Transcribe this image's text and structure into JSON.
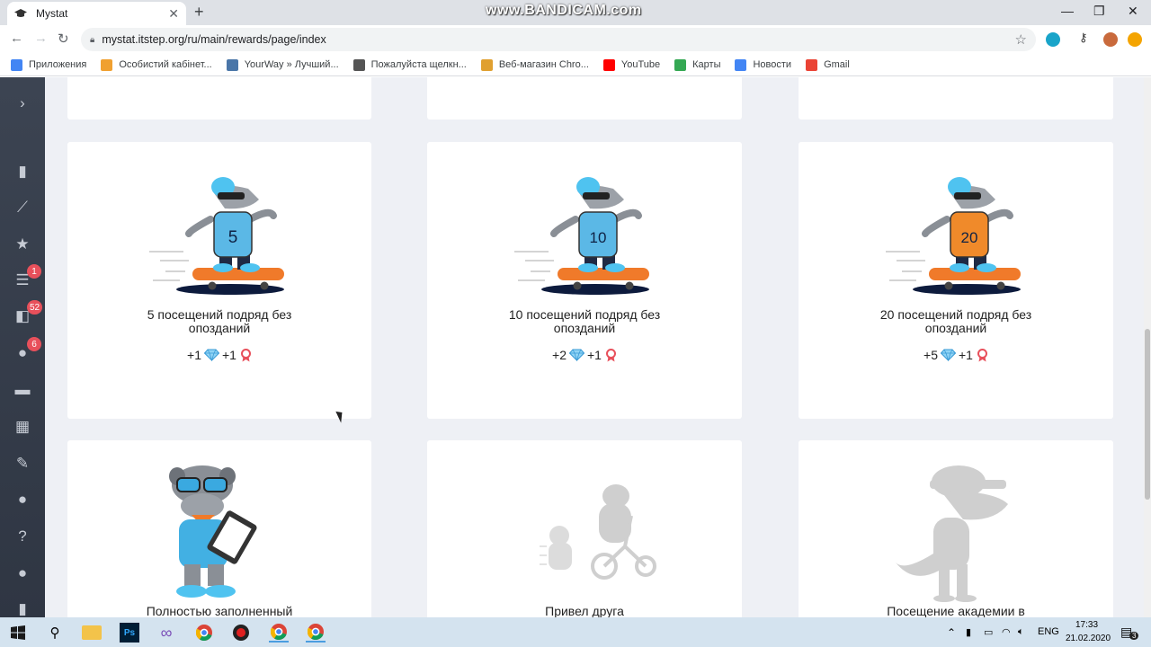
{
  "browser": {
    "tab_title": "Mystat",
    "url": "mystat.itstep.org/ru/main/rewards/page/index",
    "watermark": "www.BANDICAM.com",
    "bookmarks": [
      {
        "label": "Приложения",
        "icon": "apps-grid-icon",
        "color": "#4285f4"
      },
      {
        "label": "Особистий кабінет...",
        "icon": "rss-icon",
        "color": "#f0a030"
      },
      {
        "label": "YourWay » Лучший...",
        "icon": "vk-icon",
        "color": "#4a76a8"
      },
      {
        "label": "Пожалуйста щелкн...",
        "icon": "globe-icon",
        "color": "#555555"
      },
      {
        "label": "Веб-магазин Chro...",
        "icon": "chrome-store-icon",
        "color": "#e0a030"
      },
      {
        "label": "YouTube",
        "icon": "youtube-icon",
        "color": "#ff0000"
      },
      {
        "label": "Карты",
        "icon": "maps-icon",
        "color": "#34a853"
      },
      {
        "label": "Новости",
        "icon": "news-icon",
        "color": "#4285f4"
      },
      {
        "label": "Gmail",
        "icon": "gmail-icon",
        "color": "#ea4335"
      }
    ]
  },
  "sidebar": {
    "items": [
      {
        "icon": "chevron-right-icon",
        "glyph": "›",
        "badge": ""
      },
      {
        "icon": "bar-chart-icon",
        "glyph": "▮",
        "badge": ""
      },
      {
        "icon": "line-chart-icon",
        "glyph": "⟋",
        "badge": ""
      },
      {
        "icon": "star-icon",
        "glyph": "★",
        "badge": ""
      },
      {
        "icon": "list-icon",
        "glyph": "☰",
        "badge": "1"
      },
      {
        "icon": "homework-icon",
        "glyph": "◧",
        "badge": "52"
      },
      {
        "icon": "chat-icon",
        "glyph": "●",
        "badge": "6"
      },
      {
        "icon": "card-icon",
        "glyph": "▬",
        "badge": ""
      },
      {
        "icon": "calendar-icon",
        "glyph": "▦",
        "badge": ""
      },
      {
        "icon": "pen-icon",
        "glyph": "✎",
        "badge": ""
      },
      {
        "icon": "user-icon",
        "glyph": "●",
        "badge": ""
      },
      {
        "icon": "help-icon",
        "glyph": "?",
        "badge": ""
      },
      {
        "icon": "location-icon",
        "glyph": "●",
        "badge": ""
      },
      {
        "icon": "microphone-icon",
        "glyph": "▮",
        "badge": ""
      }
    ]
  },
  "rewards": {
    "row1": [
      {
        "title": "5 посещений подряд без опозданий",
        "number": "5",
        "coins": "+1",
        "points": "+1",
        "shirt": "#5bb8e6"
      },
      {
        "title": "10 посещений подряд без опозданий",
        "number": "10",
        "coins": "+2",
        "points": "+1",
        "shirt": "#5bb8e6"
      },
      {
        "title": "20 посещений подряд без опозданий",
        "number": "20",
        "coins": "+5",
        "points": "+1",
        "shirt": "#f08a2a"
      }
    ],
    "row2": [
      {
        "title": "Полностью заполненный"
      },
      {
        "title": "Привел друга"
      },
      {
        "title": "Посещение академии в"
      }
    ]
  },
  "taskbar": {
    "lang": "ENG",
    "time": "17:33",
    "date": "21.02.2020",
    "notifications": "3"
  }
}
